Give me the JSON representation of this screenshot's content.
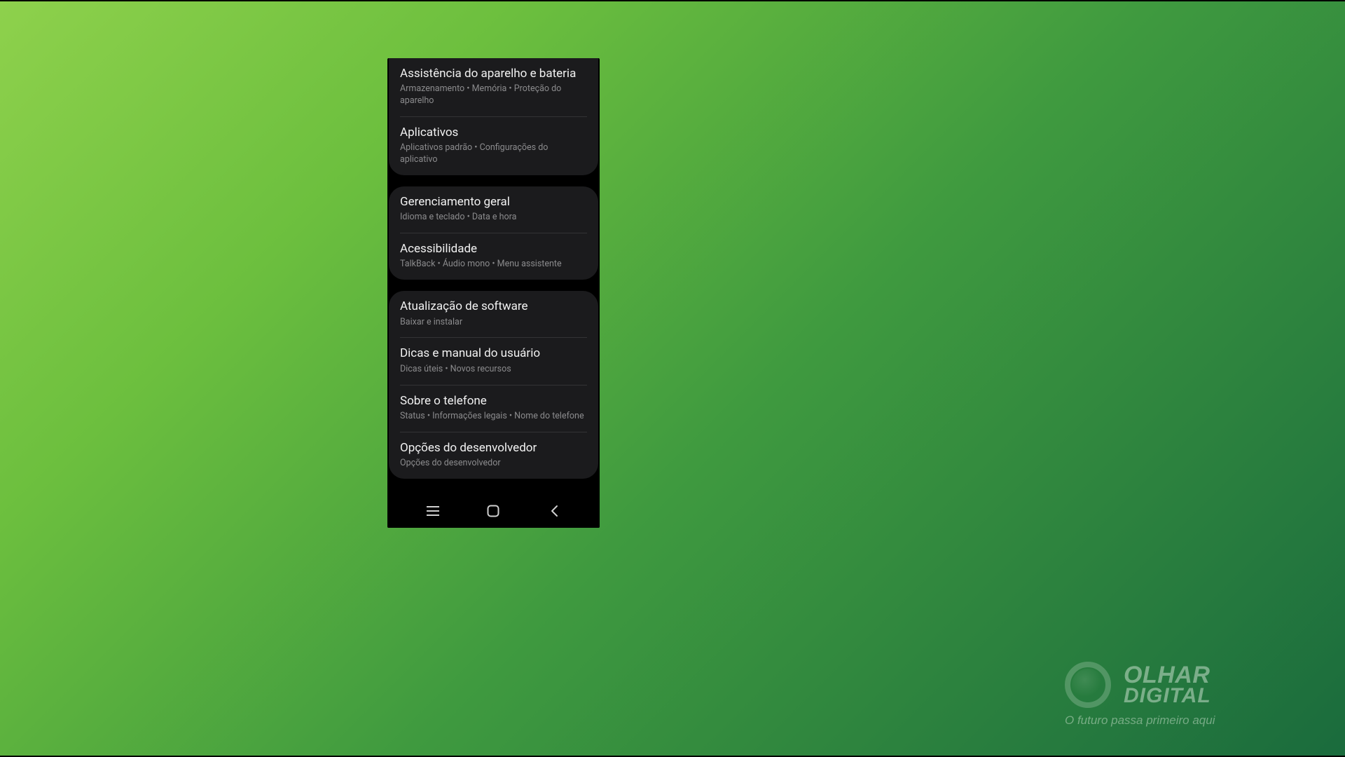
{
  "settings_groups": [
    {
      "items": [
        {
          "id": "device-care",
          "title": "Assistência do aparelho e bateria",
          "subtitle": "Armazenamento  •  Memória  •  Proteção do aparelho"
        },
        {
          "id": "apps",
          "title": "Aplicativos",
          "subtitle": "Aplicativos padrão  •  Configurações do aplicativo"
        }
      ]
    },
    {
      "items": [
        {
          "id": "general",
          "title": "Gerenciamento geral",
          "subtitle": "Idioma e teclado  •  Data e hora"
        },
        {
          "id": "accessibility",
          "title": "Acessibilidade",
          "subtitle": "TalkBack  •  Áudio mono  •  Menu assistente"
        }
      ]
    },
    {
      "items": [
        {
          "id": "sw-update",
          "title": "Atualização de software",
          "subtitle": "Baixar e instalar"
        },
        {
          "id": "tips",
          "title": "Dicas e manual do usuário",
          "subtitle": "Dicas úteis  •  Novos recursos"
        },
        {
          "id": "about-phone",
          "title": "Sobre o telefone",
          "subtitle": "Status  •  Informações legais  •  Nome do telefone"
        },
        {
          "id": "dev-options",
          "title": "Opções do desenvolvedor",
          "subtitle": "Opções do desenvolvedor"
        }
      ]
    }
  ],
  "navbar": {
    "recents": "Recents",
    "home": "Home",
    "back": "Back"
  },
  "watermark": {
    "line1": "OLHAR",
    "line2": "DIGITAL",
    "tagline": "O futuro passa primeiro aqui"
  }
}
